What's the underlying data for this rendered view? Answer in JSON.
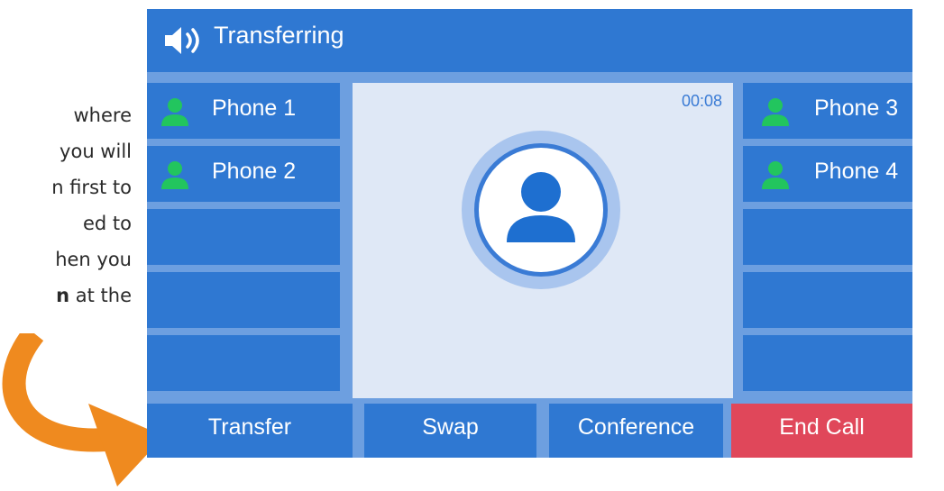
{
  "instruction_lines": [
    {
      "text": "where"
    },
    {
      "text": "you will"
    },
    {
      "text": "n first to"
    },
    {
      "text": "ed to"
    },
    {
      "text": "hen you"
    },
    {
      "bold": "n",
      "text": " at the"
    }
  ],
  "header": {
    "title": "Transferring",
    "icon": "speaker-icon"
  },
  "call": {
    "timer": "00:08"
  },
  "left_keys": [
    {
      "label": "Phone 1"
    },
    {
      "label": "Phone 2"
    },
    {
      "label": ""
    },
    {
      "label": ""
    },
    {
      "label": ""
    }
  ],
  "right_keys": [
    {
      "label": "Phone 3"
    },
    {
      "label": "Phone 4"
    },
    {
      "label": ""
    },
    {
      "label": ""
    },
    {
      "label": ""
    }
  ],
  "softkeys": {
    "transfer": "Transfer",
    "swap": "Swap",
    "conference": "Conference",
    "end_call": "End Call"
  },
  "colors": {
    "screen_bg": "#6d9fe0",
    "key_blue": "#2f78d2",
    "end_call_red": "#e0475a",
    "presence_green": "#22c55e",
    "arrow_orange": "#ef8a1f"
  }
}
